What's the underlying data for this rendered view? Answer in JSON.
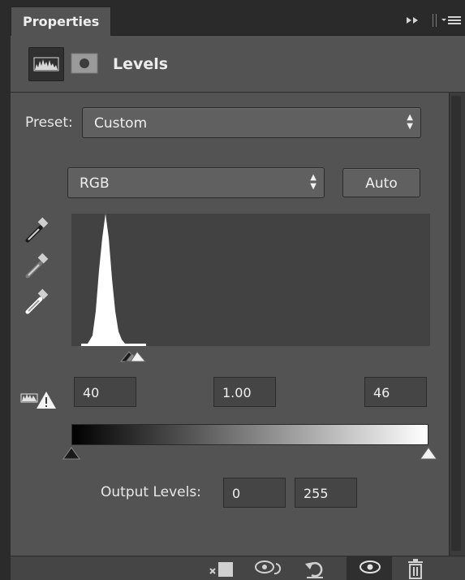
{
  "panel": {
    "tab_label": "Properties",
    "title": "Levels",
    "menu_icons": [
      "double-chevron-right-icon",
      "panel-menu-icon"
    ]
  },
  "preset": {
    "label": "Preset:",
    "value": "Custom"
  },
  "channel": {
    "value": "RGB",
    "auto_label": "Auto"
  },
  "eyedroppers": [
    "sample-shadows-eyedropper-icon",
    "sample-midtones-eyedropper-icon",
    "sample-highlights-eyedropper-icon"
  ],
  "input_levels": {
    "shadow": "40",
    "midtone": "1.00",
    "highlight": "46"
  },
  "output_levels": {
    "label": "Output Levels:",
    "low": "0",
    "high": "255"
  },
  "toolbar_icons": [
    "clip-to-layer-icon",
    "view-previous-state-icon",
    "reset-icon",
    "toggle-visibility-icon",
    "delete-icon"
  ],
  "colors": {
    "panel_bg": "#535353",
    "field_bg": "#454545",
    "histogram_bg": "#424242"
  }
}
